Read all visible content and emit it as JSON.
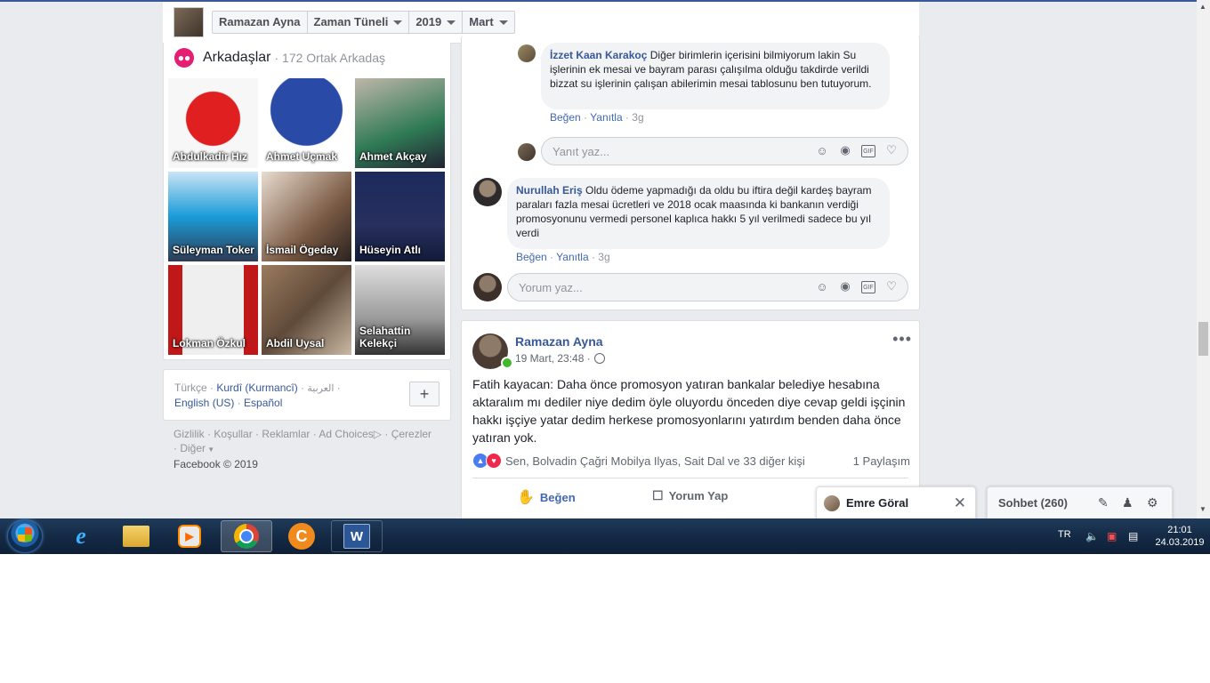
{
  "header": {
    "tabs": [
      {
        "label": "Ramazan Ayna",
        "dropdown": false
      },
      {
        "label": "Zaman Tüneli",
        "dropdown": true
      },
      {
        "label": "2019",
        "dropdown": true
      },
      {
        "label": "Mart",
        "dropdown": true
      }
    ]
  },
  "friends": {
    "title": "Arkadaşlar",
    "mutual": "· 172 Ortak Arkadaş",
    "items": [
      {
        "name": "Abdulkadir Hız"
      },
      {
        "name": "Ahmet Uçmak"
      },
      {
        "name": "Ahmet Akçay"
      },
      {
        "name": "Süleyman Toker"
      },
      {
        "name": "İsmail Ögeday"
      },
      {
        "name": "Hüseyin Atlı"
      },
      {
        "name": "Lokman Özkul"
      },
      {
        "name": "Abdil Uysal"
      },
      {
        "name": "Selahattin Kelekçi"
      }
    ]
  },
  "languages": {
    "primary": "Türkçe",
    "items": [
      "Kurdî (Kurmancî)",
      "العربية",
      "English (US)",
      "Español"
    ],
    "add_label": "+"
  },
  "footer": {
    "links": [
      "Gizlilik",
      "Koşullar",
      "Reklamlar",
      "Ad Choices",
      "Çerezler",
      "Diğer"
    ],
    "copyright": "Facebook © 2019"
  },
  "comments": {
    "reply1": {
      "author": "İzzet Kaan Karakoç",
      "text": "Diğer birimlerin içerisini bilmiyorum lakin Su işlerinin ek mesai ve bayram parası çalışılma olduğu takdirde verildi bizzat su işlerinin çalışan abilerimin mesai tablosunu ben tutuyorum.",
      "like": "Beğen",
      "reply": "Yanıtla",
      "time": "3g"
    },
    "reply_placeholder": "Yanıt yaz...",
    "comment2": {
      "author": "Nurullah Eriş",
      "text": "Oldu ödeme yapmadığı da oldu bu iftira değil kardeş bayram paraları fazla mesai ücretleri ve 2018 ocak maasında ki bankanın verdiği promosyonunu vermedi personel kaplıca hakkı 5 yıl verilmedi sadece bu yıl verdi",
      "like": "Beğen",
      "reply": "Yanıtla",
      "time": "3g"
    },
    "comment_placeholder": "Yorum yaz...",
    "input_icons": [
      "smiley-icon",
      "camera-icon",
      "gif-icon",
      "sticker-icon"
    ]
  },
  "post": {
    "author": "Ramazan Ayna",
    "date": "19 Mart, 23:48 ·",
    "text": "Fatih kayacan: Daha önce promosyon yatıran bankalar belediye hesabına aktaralım mı dediler niye dedim öyle oluyordu önceden diye cevap geldi işçinin hakkı işçiye yatar dedim herkese promosyonlarını yatırdım benden daha önce yatıran yok.",
    "reactions_text": "Sen, Bolvadin Çağri Mobilya Ilyas, Sait Dal ve 33 diğer kişi",
    "shares": "1 Paylaşım",
    "like_label": "Beğen",
    "comment_label": "Yorum Yap",
    "more": "•••"
  },
  "chat": {
    "open_tab_name": "Emre Göral",
    "sidebar_label": "Sohbet (260)"
  },
  "taskbar": {
    "apps": [
      "windows-start",
      "internet-explorer",
      "file-explorer",
      "media-player",
      "chrome",
      "c-app",
      "word"
    ],
    "lang": "TR",
    "time": "21:01",
    "date": "24.03.2019"
  },
  "colors": {
    "facebook_blue": "#3b5998",
    "link_blue": "#385898",
    "action_blue": "#4267b2",
    "bg_gray": "#e9ebee",
    "friends_icon": "#e41e72",
    "online_green": "#42b72a"
  }
}
